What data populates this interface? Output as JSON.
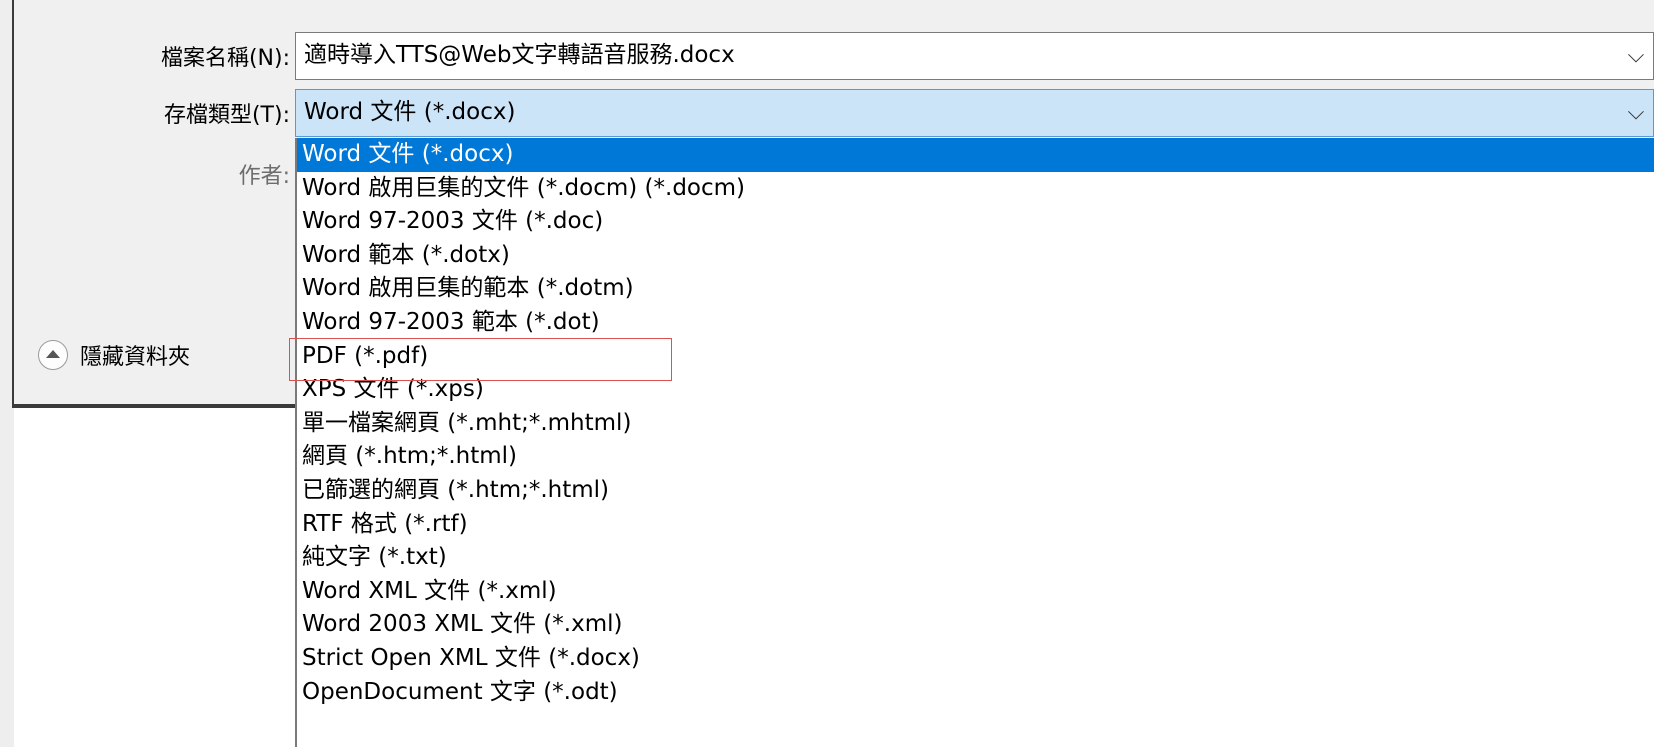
{
  "form": {
    "filename_label": "檔案名稱(N):",
    "filename_value": "適時導入TTS@Web文字轉語音服務.docx",
    "filetype_label": "存檔類型(T):",
    "filetype_value": "Word 文件 (*.docx)",
    "author_label": "作者:"
  },
  "hide_folders": {
    "label": "隱藏資料夾",
    "icon": "collapse-up-icon"
  },
  "dropdown_options": [
    {
      "label": "Word 文件 (*.docx)",
      "selected": true
    },
    {
      "label": "Word 啟用巨集的文件 (*.docm) (*.docm)"
    },
    {
      "label": "Word 97-2003 文件 (*.doc)"
    },
    {
      "label": "Word 範本 (*.dotx)"
    },
    {
      "label": "Word 啟用巨集的範本 (*.dotm)"
    },
    {
      "label": "Word 97-2003 範本 (*.dot)"
    },
    {
      "label": "PDF (*.pdf)",
      "highlighted": true
    },
    {
      "label": "XPS 文件 (*.xps)"
    },
    {
      "label": "單一檔案網頁 (*.mht;*.mhtml)"
    },
    {
      "label": "網頁 (*.htm;*.html)"
    },
    {
      "label": "已篩選的網頁 (*.htm;*.html)"
    },
    {
      "label": "RTF 格式 (*.rtf)"
    },
    {
      "label": "純文字 (*.txt)"
    },
    {
      "label": "Word XML 文件 (*.xml)"
    },
    {
      "label": "Word 2003 XML 文件 (*.xml)"
    },
    {
      "label": "Strict Open XML 文件 (*.docx)"
    },
    {
      "label": "OpenDocument 文字 (*.odt)"
    }
  ],
  "colors": {
    "selected_bg": "#0078d7",
    "field_focus_bg": "#cce4f7",
    "highlight_border": "#d9534f"
  }
}
